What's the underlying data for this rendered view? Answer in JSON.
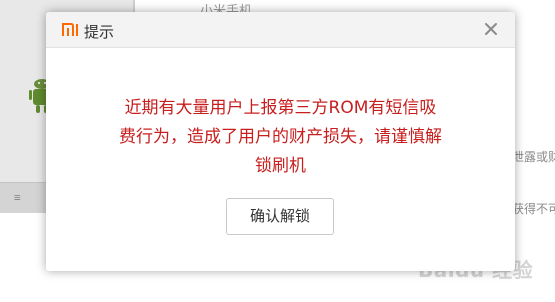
{
  "background": {
    "top_text": "小米手机",
    "right_text_1": "泄露或财",
    "right_text_2": "获得不可",
    "bar_icon": "≡",
    "watermark": "Baidu 经验",
    "watermark_sub": "jingyan.baidu.com"
  },
  "dialog": {
    "logo_icon": "mi-logo-icon",
    "title": "提示",
    "close_icon": "close-icon",
    "message_lines": [
      "近期有大量用户上报第三方ROM有短信吸",
      "费行为，造成了用户的财产损失，请谨慎解",
      "锁刷机"
    ],
    "confirm_label": "确认解锁"
  },
  "colors": {
    "brand_orange": "#ff6700",
    "message_red": "#c81e1e"
  }
}
